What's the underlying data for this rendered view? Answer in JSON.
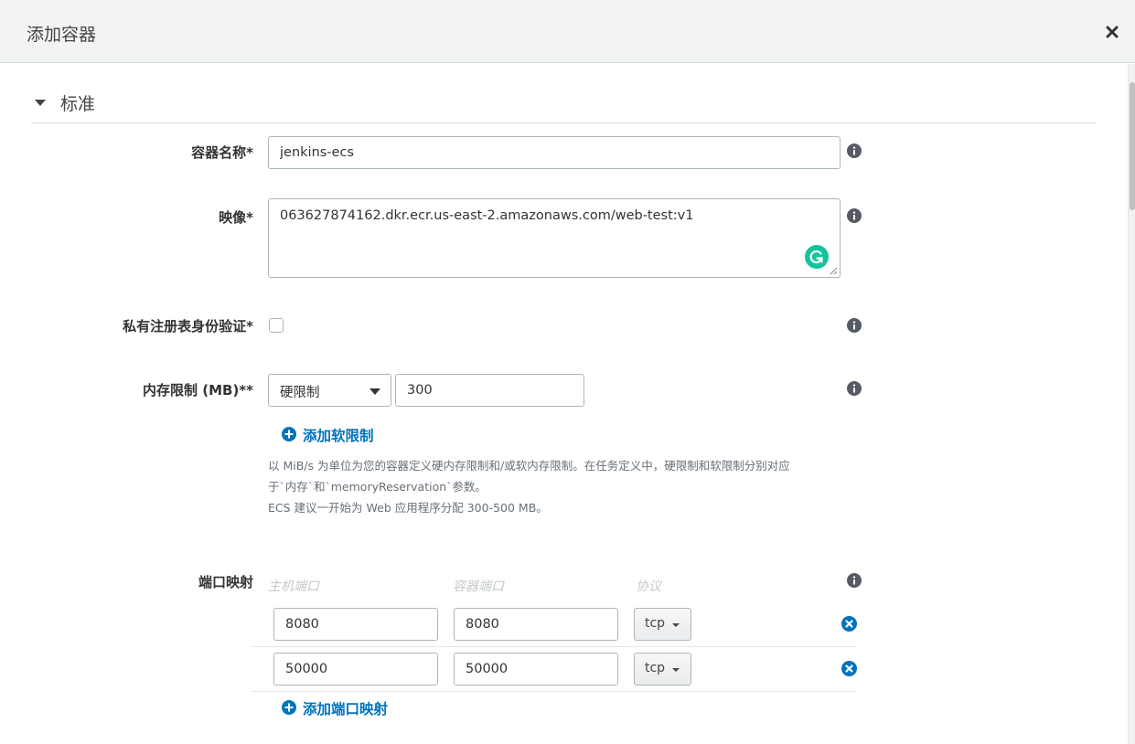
{
  "dialog": {
    "title": "添加容器",
    "close_glyph": "×"
  },
  "section": {
    "title": "标准"
  },
  "fields": {
    "container_name": {
      "label": "容器名称*",
      "value": "jenkins-ecs"
    },
    "image": {
      "label": "映像*",
      "value": "063627874162.dkr.ecr.us-east-2.amazonaws.com/web-test:v1"
    },
    "private_registry": {
      "label": "私有注册表身份验证*",
      "checked": false
    },
    "memory": {
      "label": "内存限制 (MB)**",
      "limit_type": "硬限制",
      "value": "300",
      "add_soft_limit": "添加软限制",
      "help_line1": "以 MiB/s 为单位为您的容器定义硬内存限制和/或软内存限制。在任务定义中，硬限制和软限制分别对应",
      "help_line2": "于`内存`和`memoryReservation`参数。",
      "help_line3": "ECS 建议一开始为 Web 应用程序分配 300-500 MB。"
    },
    "port_mappings": {
      "label": "端口映射",
      "headers": {
        "host_port": "主机端口",
        "container_port": "容器端口",
        "protocol": "协议"
      },
      "rows": [
        {
          "host_port": "8080",
          "container_port": "8080",
          "protocol": "tcp"
        },
        {
          "host_port": "50000",
          "container_port": "50000",
          "protocol": "tcp"
        }
      ],
      "add_mapping": "添加端口映射"
    }
  },
  "colors": {
    "link": "#0073bb",
    "header_bg": "#f2f3f3",
    "grammarly": "#15c39a"
  },
  "icons": [
    "close-icon",
    "caret-down-icon",
    "info-icon",
    "plus-circle-icon",
    "remove-circle-icon",
    "grammarly-icon",
    "resize-handle-icon"
  ]
}
